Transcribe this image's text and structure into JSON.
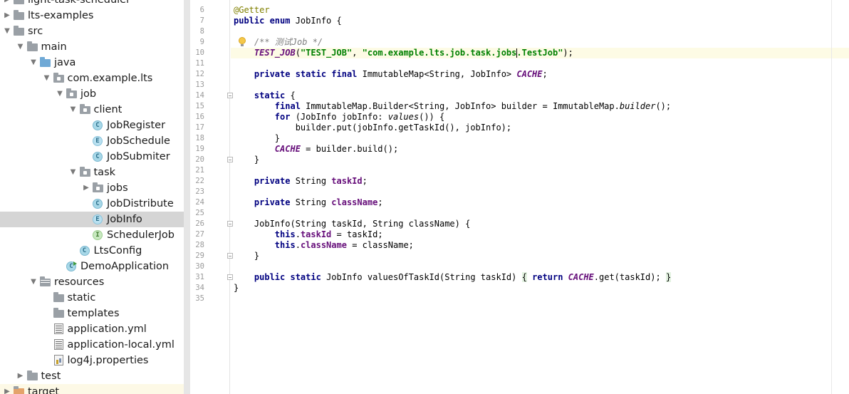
{
  "project_tree": [
    {
      "label": "light-task-scheduler",
      "indent": 0,
      "arrow": "right",
      "icon": "folder-icon",
      "state": "normal"
    },
    {
      "label": "lts-examples",
      "indent": 0,
      "arrow": "right",
      "icon": "folder-icon",
      "state": "normal"
    },
    {
      "label": "src",
      "indent": 0,
      "arrow": "down",
      "icon": "folder-icon",
      "state": "normal"
    },
    {
      "label": "main",
      "indent": 1,
      "arrow": "down",
      "icon": "folder-icon",
      "state": "normal"
    },
    {
      "label": "java",
      "indent": 2,
      "arrow": "down",
      "icon": "source-folder-icon",
      "state": "normal"
    },
    {
      "label": "com.example.lts",
      "indent": 3,
      "arrow": "down",
      "icon": "package-icon",
      "state": "normal"
    },
    {
      "label": "job",
      "indent": 4,
      "arrow": "down",
      "icon": "package-icon",
      "state": "normal"
    },
    {
      "label": "client",
      "indent": 5,
      "arrow": "down",
      "icon": "package-icon",
      "state": "normal"
    },
    {
      "label": "JobRegister",
      "indent": 6,
      "arrow": "",
      "icon": "class-icon",
      "state": "normal"
    },
    {
      "label": "JobSchedule",
      "indent": 6,
      "arrow": "",
      "icon": "enum-icon",
      "state": "normal"
    },
    {
      "label": "JobSubmiter",
      "indent": 6,
      "arrow": "",
      "icon": "class-icon",
      "state": "normal"
    },
    {
      "label": "task",
      "indent": 5,
      "arrow": "down",
      "icon": "package-icon",
      "state": "normal"
    },
    {
      "label": "jobs",
      "indent": 6,
      "arrow": "right",
      "icon": "package-icon",
      "state": "normal"
    },
    {
      "label": "JobDistribute",
      "indent": 6,
      "arrow": "",
      "icon": "class-icon",
      "state": "normal"
    },
    {
      "label": "JobInfo",
      "indent": 6,
      "arrow": "",
      "icon": "enum-icon",
      "state": "selected"
    },
    {
      "label": "SchedulerJob",
      "indent": 6,
      "arrow": "",
      "icon": "interface-icon",
      "state": "normal"
    },
    {
      "label": "LtsConfig",
      "indent": 5,
      "arrow": "",
      "icon": "class-icon",
      "state": "normal"
    },
    {
      "label": "DemoApplication",
      "indent": 4,
      "arrow": "",
      "icon": "app-class-icon",
      "state": "normal"
    },
    {
      "label": "resources",
      "indent": 2,
      "arrow": "down",
      "icon": "resources-folder-icon",
      "state": "normal"
    },
    {
      "label": "static",
      "indent": 3,
      "arrow": "",
      "icon": "folder-icon",
      "state": "normal"
    },
    {
      "label": "templates",
      "indent": 3,
      "arrow": "",
      "icon": "folder-icon",
      "state": "normal"
    },
    {
      "label": "application.yml",
      "indent": 3,
      "arrow": "",
      "icon": "yml-file-icon",
      "state": "normal"
    },
    {
      "label": "application-local.yml",
      "indent": 3,
      "arrow": "",
      "icon": "yml-file-icon",
      "state": "normal"
    },
    {
      "label": "log4j.properties",
      "indent": 3,
      "arrow": "",
      "icon": "properties-file-icon",
      "state": "normal"
    },
    {
      "label": "test",
      "indent": 1,
      "arrow": "right",
      "icon": "folder-icon",
      "state": "normal"
    },
    {
      "label": "target",
      "indent": 0,
      "arrow": "right",
      "icon": "excluded-folder-icon",
      "state": "highlighted"
    }
  ],
  "editor": {
    "lines": [
      {
        "n": "6",
        "tokens": [
          [
            "anno",
            "@Getter"
          ]
        ]
      },
      {
        "n": "7",
        "tokens": [
          [
            "kw",
            "public enum "
          ],
          [
            "",
            "JobInfo {"
          ]
        ]
      },
      {
        "n": "8",
        "tokens": []
      },
      {
        "n": "9",
        "tokens": [
          [
            "",
            "    "
          ],
          [
            "cmt",
            "/** 测试Job */"
          ]
        ]
      },
      {
        "n": "10",
        "tokens": [
          [
            "",
            "    "
          ],
          [
            "sfld",
            "TEST_JOB"
          ],
          [
            "",
            "("
          ],
          [
            "str",
            "\"TEST_JOB\""
          ],
          [
            "",
            ", "
          ],
          [
            "str",
            "\"com.example.lts.job.task.jobs"
          ],
          [
            "caret",
            ""
          ],
          [
            "str",
            ".TestJob\""
          ],
          [
            "",
            ");"
          ]
        ]
      },
      {
        "n": "11",
        "tokens": []
      },
      {
        "n": "12",
        "tokens": [
          [
            "",
            "    "
          ],
          [
            "kw",
            "private static final "
          ],
          [
            "",
            "ImmutableMap<String, JobInfo> "
          ],
          [
            "sfld",
            "CACHE"
          ],
          [
            "",
            ";"
          ]
        ]
      },
      {
        "n": "13",
        "tokens": []
      },
      {
        "n": "14",
        "tokens": [
          [
            "",
            "    "
          ],
          [
            "kw",
            "static "
          ],
          [
            "",
            "{"
          ]
        ]
      },
      {
        "n": "15",
        "tokens": [
          [
            "",
            "        "
          ],
          [
            "kw",
            "final "
          ],
          [
            "",
            "ImmutableMap.Builder<String, JobInfo> builder = ImmutableMap."
          ],
          [
            "ital",
            "builder"
          ],
          [
            "",
            "();"
          ]
        ]
      },
      {
        "n": "16",
        "tokens": [
          [
            "",
            "        "
          ],
          [
            "kw",
            "for "
          ],
          [
            "",
            "(JobInfo jobInfo: "
          ],
          [
            "ital",
            "values"
          ],
          [
            "",
            "()) {"
          ]
        ]
      },
      {
        "n": "17",
        "tokens": [
          [
            "",
            "            builder.put(jobInfo.getTaskId(), jobInfo);"
          ]
        ]
      },
      {
        "n": "18",
        "tokens": [
          [
            "",
            "        }"
          ]
        ]
      },
      {
        "n": "19",
        "tokens": [
          [
            "",
            "        "
          ],
          [
            "sfld",
            "CACHE"
          ],
          [
            "",
            " = builder.build();"
          ]
        ]
      },
      {
        "n": "20",
        "tokens": [
          [
            "",
            "    }"
          ]
        ]
      },
      {
        "n": "21",
        "tokens": []
      },
      {
        "n": "22",
        "tokens": [
          [
            "",
            "    "
          ],
          [
            "kw",
            "private "
          ],
          [
            "",
            "String "
          ],
          [
            "fld",
            "taskId"
          ],
          [
            "",
            ";"
          ]
        ]
      },
      {
        "n": "23",
        "tokens": []
      },
      {
        "n": "24",
        "tokens": [
          [
            "",
            "    "
          ],
          [
            "kw",
            "private "
          ],
          [
            "",
            "String "
          ],
          [
            "fld",
            "className"
          ],
          [
            "",
            ";"
          ]
        ]
      },
      {
        "n": "25",
        "tokens": []
      },
      {
        "n": "26",
        "tokens": [
          [
            "",
            "    JobInfo(String taskId, String className) {"
          ]
        ]
      },
      {
        "n": "27",
        "tokens": [
          [
            "",
            "        "
          ],
          [
            "kw",
            "this"
          ],
          [
            "",
            "."
          ],
          [
            "fld",
            "taskId"
          ],
          [
            "",
            " = taskId;"
          ]
        ]
      },
      {
        "n": "28",
        "tokens": [
          [
            "",
            "        "
          ],
          [
            "kw",
            "this"
          ],
          [
            "",
            "."
          ],
          [
            "fld",
            "className"
          ],
          [
            "",
            " = className;"
          ]
        ]
      },
      {
        "n": "29",
        "tokens": [
          [
            "",
            "    }"
          ]
        ]
      },
      {
        "n": "30",
        "tokens": []
      },
      {
        "n": "31",
        "tokens": [
          [
            "",
            "    "
          ],
          [
            "kw",
            "public static "
          ],
          [
            "",
            "JobInfo valuesOfTaskId(String taskId) "
          ],
          [
            "brace",
            "{"
          ],
          [
            "",
            " "
          ],
          [
            "kw",
            "return "
          ],
          [
            "sfld",
            "CACHE"
          ],
          [
            "",
            ".get(taskId); "
          ],
          [
            "brace",
            "}"
          ]
        ]
      },
      {
        "n": "34",
        "tokens": [
          [
            "",
            "}"
          ]
        ]
      },
      {
        "n": "35",
        "tokens": []
      }
    ],
    "folded_lines": [
      "14",
      "20",
      "26",
      "29",
      "31"
    ],
    "current_line": "10"
  },
  "colors": {
    "keyword": "#000080",
    "string": "#008000",
    "field": "#660e7a",
    "annotation": "#808000",
    "comment": "#808080",
    "selection": "#d5d5d5",
    "current_line": "#fdfbe5"
  }
}
